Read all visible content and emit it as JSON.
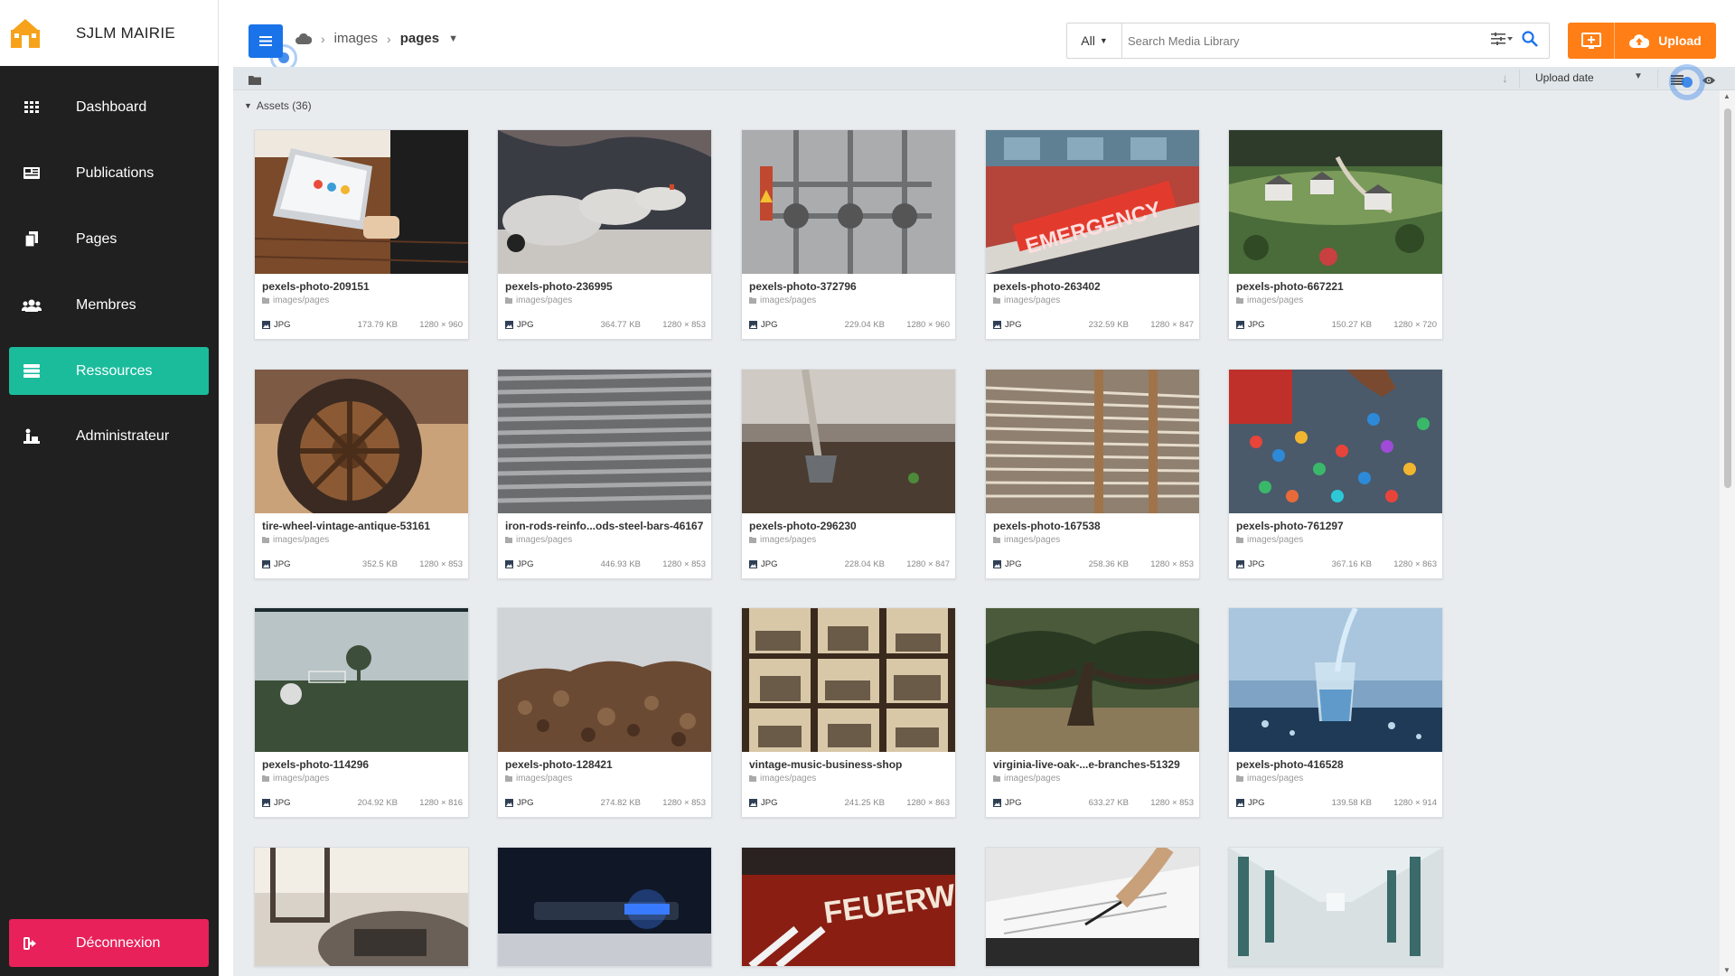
{
  "app": {
    "name": "SJLM MAIRIE"
  },
  "sidebar": {
    "items": [
      {
        "label": "Dashboard",
        "icon": "grid-icon"
      },
      {
        "label": "Publications",
        "icon": "newspaper-icon"
      },
      {
        "label": "Pages",
        "icon": "copy-icon"
      },
      {
        "label": "Membres",
        "icon": "users-icon"
      },
      {
        "label": "Ressources",
        "icon": "database-icon",
        "active": true
      },
      {
        "label": "Administrateur",
        "icon": "admin-icon"
      }
    ],
    "logout_label": "Déconnexion"
  },
  "breadcrumb": {
    "root": "images",
    "current": "pages"
  },
  "search": {
    "filter": "All",
    "placeholder": "Search Media Library"
  },
  "upload": {
    "label": "Upload"
  },
  "toolbar": {
    "sort_label": "Upload date"
  },
  "assets": {
    "header": "Assets (36)",
    "folder_path": "images/pages",
    "items": [
      {
        "name": "pexels-photo-209151",
        "type": "JPG",
        "size": "173.79 KB",
        "dims": "1280 × 960"
      },
      {
        "name": "pexels-photo-236995",
        "type": "JPG",
        "size": "364.77 KB",
        "dims": "1280 × 853"
      },
      {
        "name": "pexels-photo-372796",
        "type": "JPG",
        "size": "229.04 KB",
        "dims": "1280 × 960"
      },
      {
        "name": "pexels-photo-263402",
        "type": "JPG",
        "size": "232.59 KB",
        "dims": "1280 × 847"
      },
      {
        "name": "pexels-photo-667221",
        "type": "JPG",
        "size": "150.27 KB",
        "dims": "1280 × 720"
      },
      {
        "name": "tire-wheel-vintage-antique-53161",
        "type": "JPG",
        "size": "352.5 KB",
        "dims": "1280 × 853"
      },
      {
        "name": "iron-rods-reinfo...ods-steel-bars-46167",
        "type": "JPG",
        "size": "446.93 KB",
        "dims": "1280 × 853"
      },
      {
        "name": "pexels-photo-296230",
        "type": "JPG",
        "size": "228.04 KB",
        "dims": "1280 × 847"
      },
      {
        "name": "pexels-photo-167538",
        "type": "JPG",
        "size": "258.36 KB",
        "dims": "1280 × 853"
      },
      {
        "name": "pexels-photo-761297",
        "type": "JPG",
        "size": "367.16 KB",
        "dims": "1280 × 863"
      },
      {
        "name": "pexels-photo-114296",
        "type": "JPG",
        "size": "204.92 KB",
        "dims": "1280 × 816"
      },
      {
        "name": "pexels-photo-128421",
        "type": "JPG",
        "size": "274.82 KB",
        "dims": "1280 × 853"
      },
      {
        "name": "vintage-music-business-shop",
        "type": "JPG",
        "size": "241.25 KB",
        "dims": "1280 × 863"
      },
      {
        "name": "virginia-live-oak-...e-branches-51329",
        "type": "JPG",
        "size": "633.27 KB",
        "dims": "1280 × 853"
      },
      {
        "name": "pexels-photo-416528",
        "type": "JPG",
        "size": "139.58 KB",
        "dims": "1280 × 914"
      }
    ]
  },
  "colors": {
    "sidebar_bg": "#202020",
    "active_item": "#1abc9c",
    "logout": "#e8215a",
    "primary": "#1a73e8",
    "upload": "#ff7f16"
  }
}
